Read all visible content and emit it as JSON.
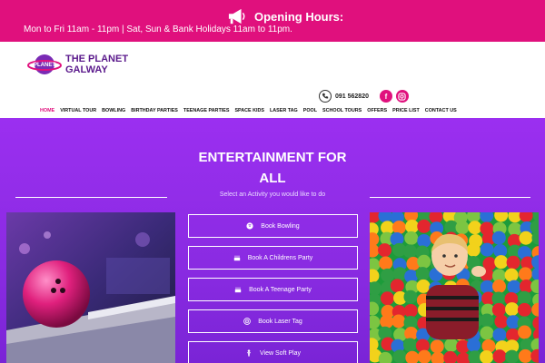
{
  "topbar": {
    "hours_label": "Opening Hours:",
    "hours_text": "Mon to Fri 11am - 11pm | Sat, Sun & Bank Holidays 11am to 11pm.",
    "icon": "megaphone-icon"
  },
  "logo": {
    "line1": "THE PLANET",
    "line2": "GALWAY",
    "badge_text": "PLANET"
  },
  "contact": {
    "phone": "091 562820",
    "phone_icon": "phone-icon",
    "facebook_icon": "facebook-icon",
    "instagram_icon": "instagram-icon",
    "facebook_glyph": "f"
  },
  "nav": {
    "items": [
      {
        "label": "HOME"
      },
      {
        "label": "VIRTUAL TOUR"
      },
      {
        "label": "BOWLING"
      },
      {
        "label": "BIRTHDAY PARTIES"
      },
      {
        "label": "TEENAGE PARTIES"
      },
      {
        "label": "SPACE KIDS"
      },
      {
        "label": "LASER TAG"
      },
      {
        "label": "POOL"
      },
      {
        "label": "SCHOOL TOURS"
      },
      {
        "label": "OFFERS"
      },
      {
        "label": "PRICE LIST"
      },
      {
        "label": "CONTACT US"
      }
    ],
    "active_index": 0
  },
  "hero": {
    "title_line1": "ENTERTAINMENT FOR",
    "title_line2": "ALL",
    "subtitle": "Select an Activity you would like to do"
  },
  "actions": [
    {
      "label": "Book Bowling",
      "icon": "bowling-ball-icon"
    },
    {
      "label": "Book A Childrens Party",
      "icon": "cake-icon"
    },
    {
      "label": "Book A Teenage Party",
      "icon": "cake-icon"
    },
    {
      "label": "Book Laser Tag",
      "icon": "target-icon"
    },
    {
      "label": "View Soft Play",
      "icon": "child-icon"
    }
  ],
  "colors": {
    "brand_pink": "#e0107d",
    "brand_purple": "#5b1a8c",
    "hero_purple": "#8a2be2"
  }
}
